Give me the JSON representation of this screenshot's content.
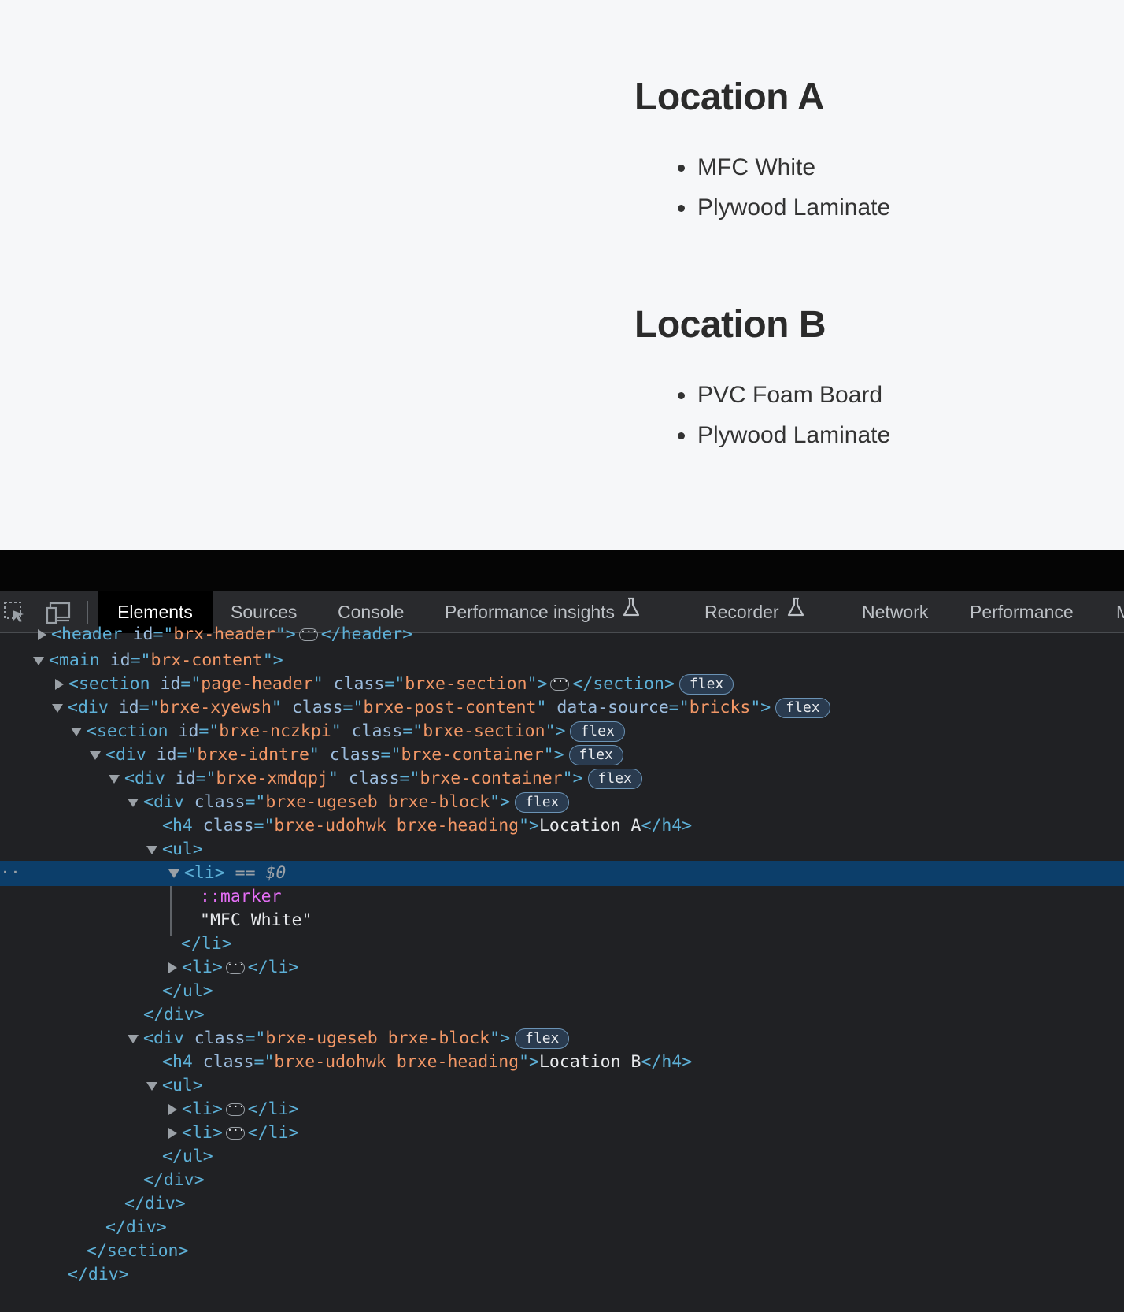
{
  "preview": {
    "blocks": [
      {
        "heading": "Location A",
        "items": [
          "MFC White",
          "Plywood Laminate"
        ]
      },
      {
        "heading": "Location B",
        "items": [
          "PVC Foam Board",
          "Plywood Laminate"
        ]
      }
    ]
  },
  "devtools": {
    "tabs": [
      "Elements",
      "Sources",
      "Console",
      "Performance insights",
      "Recorder",
      "Network",
      "Performance",
      "M"
    ],
    "active_tab": "Elements",
    "badge": "flex",
    "selected_suffix": "== $0",
    "tree": {
      "header": {
        "tag": "header",
        "id_attr": "id",
        "id": "brx-header"
      },
      "main": {
        "tag": "main",
        "id": "brx-content"
      },
      "page_header": {
        "id": "page-header",
        "class": "brxe-section"
      },
      "post_content": {
        "id": "brxe-xyewsh",
        "class": "brxe-post-content",
        "ds_attr": "data-source",
        "ds": "bricks"
      },
      "section": {
        "id": "brxe-nczkpi",
        "class": "brxe-section"
      },
      "container1": {
        "id": "brxe-idntre",
        "class": "brxe-container"
      },
      "container2": {
        "id": "brxe-xmdqpj",
        "class": "brxe-container"
      },
      "block_class": "brxe-ugeseb brxe-block",
      "heading_class": "brxe-udohwk brxe-heading",
      "heading_a": "Location A",
      "heading_b": "Location B",
      "marker": "::marker",
      "li_text": "\"MFC White\""
    }
  },
  "colors": {
    "page_bg": "#f6f7f9",
    "devtools_bg": "#202124",
    "selected_row": "#0c3e6a",
    "tag": "#5db0d7",
    "attr_value": "#f29766"
  }
}
